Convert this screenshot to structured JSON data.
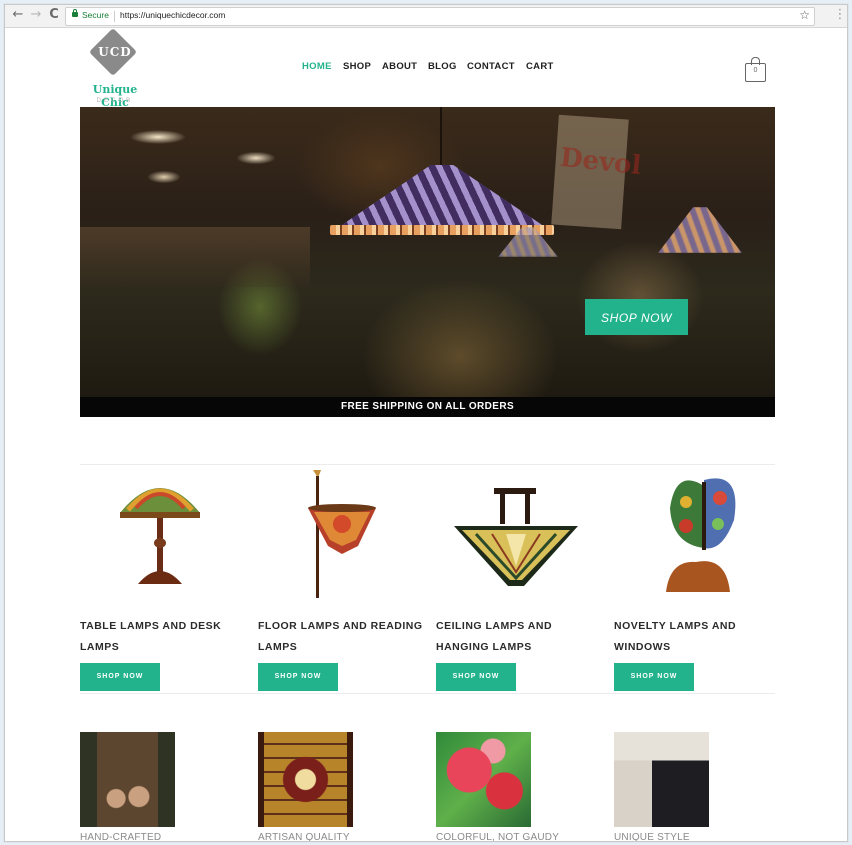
{
  "browser": {
    "secure_label": "Secure",
    "url": "https://uniquechicdecor.com",
    "back_icon": "←",
    "forward_icon": "→",
    "reload_icon": "C",
    "star_icon": "☆",
    "menu_icon": "⋮"
  },
  "brand": {
    "monogram": "UCD",
    "name": "Unique Chic",
    "tagline": "DECOR",
    "accent": "#22b38d"
  },
  "nav": {
    "items": [
      "HOME",
      "SHOP",
      "ABOUT",
      "BLOG",
      "CONTACT",
      "CART"
    ],
    "active": "HOME",
    "cart_count": "0"
  },
  "hero": {
    "cta": "SHOP NOW",
    "strip": "FREE SHIPPING ON ALL ORDERS",
    "sign_text": "Devol"
  },
  "categories": [
    {
      "title": "TABLE LAMPS AND DESK LAMPS",
      "button": "SHOP NOW"
    },
    {
      "title": "FLOOR LAMPS AND READING LAMPS",
      "button": "SHOP NOW"
    },
    {
      "title": "CEILING LAMPS AND HANGING LAMPS",
      "button": "SHOP NOW"
    },
    {
      "title": "NOVELTY LAMPS AND WINDOWS",
      "button": "SHOP NOW"
    }
  ],
  "features": [
    {
      "caption": "HAND-CRAFTED"
    },
    {
      "caption": "ARTISAN QUALITY"
    },
    {
      "caption": "COLORFUL, NOT GAUDY"
    },
    {
      "caption": "UNIQUE STYLE"
    }
  ]
}
